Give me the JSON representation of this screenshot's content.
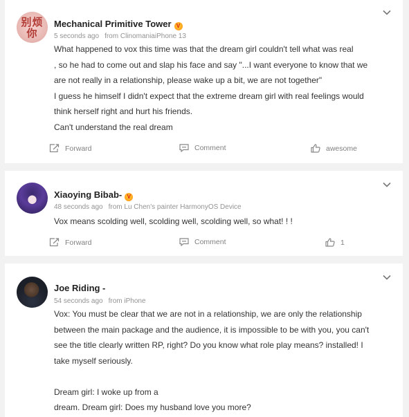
{
  "posts": [
    {
      "author": "Mechanical Primitive Tower",
      "avatar_text": [
        "别烦",
        "你"
      ],
      "badge": "icon-vip-badge",
      "time": "5 seconds ago",
      "source": "from ClinomaniaiPhone 13",
      "lines": [
        "What happened to vox this time was that the dream girl couldn't tell what was real",
        ", so he had to come out and slap his face and say \"...I want everyone to know that we",
        "are not really in a relationship, please wake up a bit, we are not together\"",
        "I guess he himself I didn't expect that the extreme dream girl with real feelings would",
        "think herself right and hurt his friends.",
        "Can't understand the real dream"
      ],
      "forward_label": "Forward",
      "comment_label": "Comment",
      "like_label": "awesome"
    },
    {
      "author": "Xiaoying Bibab-",
      "badge": "icon-vip-badge",
      "time": "48 seconds ago",
      "source": "from Lu Chen's painter HarmonyOS Device",
      "lines": [
        "Vox means scolding well, scolding well, scolding well, so what! ! !"
      ],
      "forward_label": "Forward",
      "comment_label": "Comment",
      "like_label": "1"
    },
    {
      "author": "Joe Riding -",
      "time": "54 seconds ago",
      "source": "from iPhone",
      "lines": [
        "Vox: You must be clear that we are not in a relationship, we are only the relationship",
        "between the main package and the audience, it is impossible to be with you, you can't",
        "see the title clearly written RP, right? Do you know what role play means? installed! I",
        "take myself seriously.",
        "",
        "Dream girl: I woke up from a",
        "dream. Dream girl: Does my husband love you more?"
      ]
    }
  ],
  "colors": {
    "background": "#f2f2f2",
    "card": "#ffffff",
    "text": "#333333",
    "meta": "#939393",
    "action": "#808080"
  }
}
